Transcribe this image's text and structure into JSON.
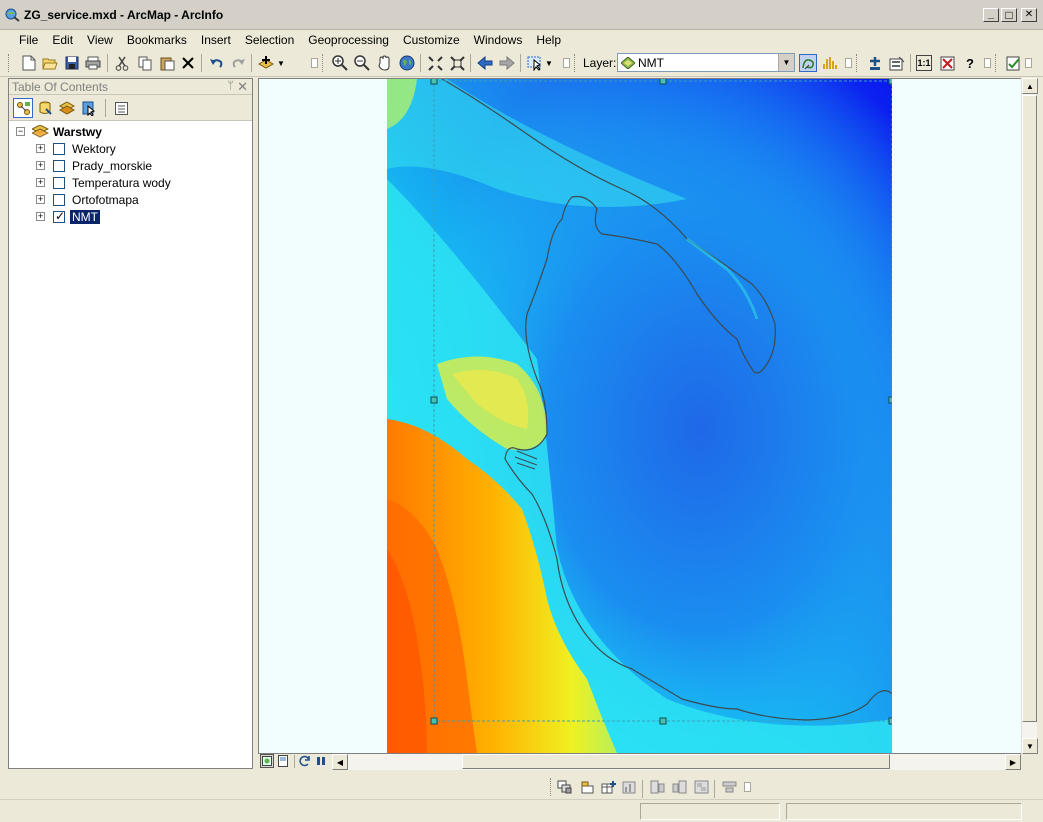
{
  "window": {
    "title": "ZG_service.mxd - ArcMap - ArcInfo",
    "minimize": "_",
    "maximize": "□",
    "close": "✕"
  },
  "menu": [
    "File",
    "Edit",
    "View",
    "Bookmarks",
    "Insert",
    "Selection",
    "Geoprocessing",
    "Customize",
    "Windows",
    "Help"
  ],
  "toolbar": {
    "layer_label": "Layer:",
    "layer_value": "NMT",
    "scale_label": "1:1",
    "help_label": "?"
  },
  "toc": {
    "title": "Table Of Contents",
    "pin": "ᛘ",
    "close": "✕",
    "group": "Warstwy",
    "layers": [
      {
        "name": "Wektory",
        "checked": false
      },
      {
        "name": "Prady_morskie",
        "checked": false
      },
      {
        "name": "Temperatura wody",
        "checked": false
      },
      {
        "name": "Ortofotmapa",
        "checked": false
      },
      {
        "name": "NMT",
        "checked": true,
        "selected": true
      }
    ]
  },
  "colors": {
    "selection": "#0a246a",
    "map_background": "#f2fdfd"
  }
}
